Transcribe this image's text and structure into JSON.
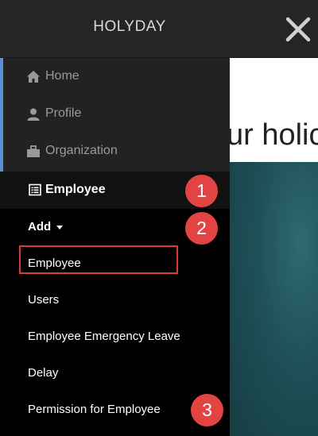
{
  "topbar": {
    "title": "HOLYDAY"
  },
  "sidebar": {
    "items": [
      {
        "label": "Home",
        "icon": "home-icon"
      },
      {
        "label": "Profile",
        "icon": "user-icon"
      },
      {
        "label": "Organization",
        "icon": "briefcase-icon"
      }
    ],
    "active": {
      "label": "Employee",
      "icon": "list-icon"
    },
    "submenu": {
      "header": "Add",
      "items": [
        "Employee",
        "Users",
        "Employee Emergency Leave",
        "Delay",
        "Permission for Employee"
      ]
    }
  },
  "badges": [
    "1",
    "2",
    "3"
  ],
  "content": {
    "heading": "ur holic"
  },
  "colors": {
    "topbar": "#252525",
    "sidebar": "#222222",
    "submenu": "#000000",
    "accent": "#5b8fd6",
    "badge": "#e24444",
    "highlight": "#d93a3a"
  }
}
